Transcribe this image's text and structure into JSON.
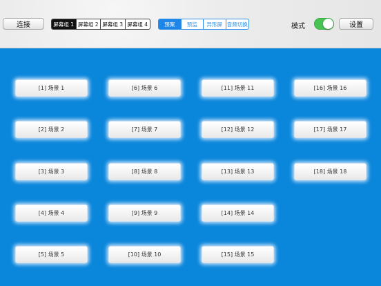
{
  "toolbar": {
    "connect_label": "连接",
    "screen_groups": [
      "屏幕组 1",
      "屏幕组 2",
      "屏幕组 3",
      "屏幕组 4"
    ],
    "screen_group_selected": 0,
    "views": [
      "预案",
      "预监",
      "异形屏",
      "音频切换"
    ],
    "view_selected": 0,
    "mode_label": "模式",
    "mode_on": true,
    "settings_label": "设置"
  },
  "scenes": [
    {
      "label": "[1] 场景 1"
    },
    {
      "label": "[2] 场景 2"
    },
    {
      "label": "[3] 场景 3"
    },
    {
      "label": "[4] 场景 4"
    },
    {
      "label": "[5] 场景 5"
    },
    {
      "label": "[6] 场景 6"
    },
    {
      "label": "[7] 场景 7"
    },
    {
      "label": "[8] 场景 8"
    },
    {
      "label": "[9] 场景 9"
    },
    {
      "label": "[10] 场景 10"
    },
    {
      "label": "[11] 场景 11"
    },
    {
      "label": "[12] 场景 12"
    },
    {
      "label": "[13] 场景 13"
    },
    {
      "label": "[14] 场景 14"
    },
    {
      "label": "[15] 场景 15"
    },
    {
      "label": "[16] 场景 16"
    },
    {
      "label": "[17] 场景 17"
    },
    {
      "label": "[18] 场景 18"
    }
  ],
  "colors": {
    "content_background": "#0a86db",
    "accent_blue": "#1e86e8",
    "toggle_green": "#48c354"
  }
}
